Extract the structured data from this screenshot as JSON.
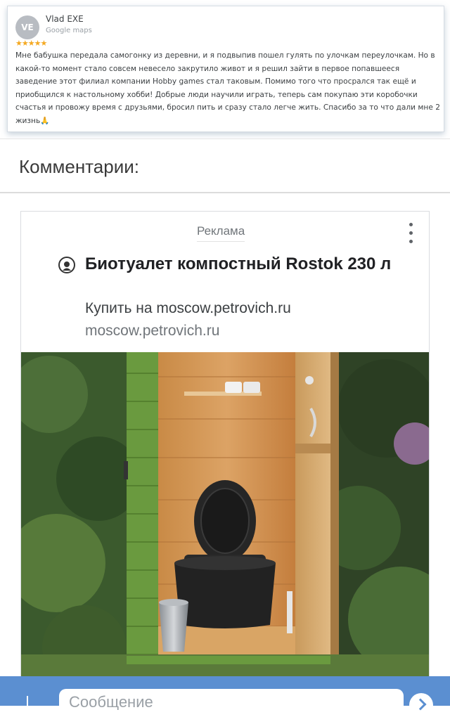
{
  "review": {
    "avatar_initials": "VE",
    "author": "Vlad EXE",
    "source": "Google maps",
    "stars": "★★★★★",
    "text": "Мне бабушка передала самогонку из деревни, и я подвыпив пошел гулять по улочкам переулочкам. Но в какой-то момент стало совсем невесело закрутило живот и я решил зайти в первое попавшееся заведение этот филиал компании Hobby games стал таковым. Помимо того что просрался так ещё и приобщился к настольному хобби! Добрые люди научили играть, теперь сам покупаю эти коробочки счастья и провожу время с друзьями, бросил пить и сразу стало легче жить. Спасибо за то что дали мне 2 жизнь🙏"
  },
  "comments": {
    "title": "Комментарии:"
  },
  "ad": {
    "label": "Реклама",
    "title": "Биотуалет компостный Rostok 230 л",
    "description": "Купить на moscow.petrovich.ru",
    "url": "moscow.petrovich.ru",
    "menu_icon": "more-vert-icon",
    "logo_icon": "petrovich-logo-icon"
  },
  "composer": {
    "placeholder": "Сообщение",
    "add_icon": "plus-icon",
    "send_icon": "send-icon"
  },
  "colors": {
    "bar": "#5b8fd1",
    "stars": "#f4a922"
  }
}
